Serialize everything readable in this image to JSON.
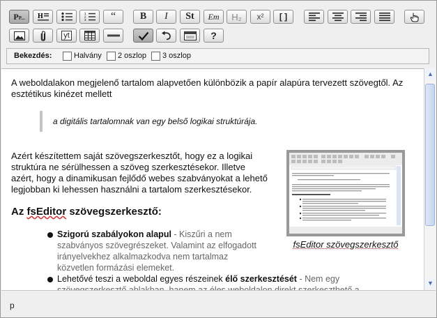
{
  "toolbar": {
    "row1": [
      {
        "name": "paragraph-style-button",
        "icon": "paragraph-style-icon",
        "text": "P..."
      },
      {
        "name": "heading-button",
        "icon": "heading-icon"
      },
      {
        "name": "bulleted-list-button",
        "icon": "bulleted-list-icon"
      },
      {
        "name": "numbered-list-button",
        "icon": "numbered-list-icon"
      },
      {
        "name": "quote-button",
        "icon": "quote-icon",
        "text": "“"
      },
      {
        "name": "bold-button",
        "icon": "bold-icon",
        "text": "B"
      },
      {
        "name": "italic-button",
        "icon": "italic-icon",
        "text": "I"
      },
      {
        "name": "strong-button",
        "icon": "strong-icon",
        "text": "St"
      },
      {
        "name": "emphasis-button",
        "icon": "emphasis-icon",
        "text": "Em"
      },
      {
        "name": "subscript-button",
        "icon": "subscript-icon",
        "text": "H₂"
      },
      {
        "name": "superscript-button",
        "icon": "superscript-icon",
        "text": "x²"
      },
      {
        "name": "code-button",
        "icon": "brackets-icon",
        "text": "[ ]"
      },
      {
        "name": "align-left-button",
        "icon": "align-left-icon"
      },
      {
        "name": "align-center-button",
        "icon": "align-center-icon"
      },
      {
        "name": "align-right-button",
        "icon": "align-right-icon"
      },
      {
        "name": "justify-button",
        "icon": "justify-icon"
      },
      {
        "name": "pointer-button",
        "icon": "hand-pointer-icon"
      }
    ],
    "row2": [
      {
        "name": "insert-image-button",
        "icon": "image-icon"
      },
      {
        "name": "attach-file-button",
        "icon": "paperclip-icon"
      },
      {
        "name": "youtube-button",
        "icon": "youtube-icon",
        "text": "yt"
      },
      {
        "name": "insert-table-button",
        "icon": "table-icon"
      },
      {
        "name": "horizontal-rule-button",
        "icon": "horizontal-rule-icon"
      },
      {
        "name": "validate-button",
        "icon": "checkmark-icon"
      },
      {
        "name": "undo-button",
        "icon": "undo-icon"
      },
      {
        "name": "source-button",
        "icon": "window-icon"
      },
      {
        "name": "help-button",
        "icon": "question-icon",
        "text": "?"
      }
    ]
  },
  "options": {
    "label": "Bekezdés:",
    "checkboxes": [
      {
        "label": "Halvány",
        "checked": false
      },
      {
        "label": "2 oszlop",
        "checked": false
      },
      {
        "label": "3 oszlop",
        "checked": false
      }
    ]
  },
  "content": {
    "intro": "A weboldalakon megjelenő tartalom alapvetően különbözik a papír alapúra tervezett szövegtől. Az esztétikus kinézet mellett",
    "quote": "a digitális tartalomnak van egy belső logikai struktúrája.",
    "para2": "Azért készítettem saját szövegszerkesztőt, hogy ez a logikai struktúra ne sérülhessen a szöveg szerkesztésekor. Illetve azért, hogy a dinamikusan fejlődő webes szabványokat a lehető legjobban ki lehessen használni a tartalom szerkesztésekor.",
    "heading_pre": "Az ",
    "heading_spell": "fsEditor",
    "heading_post": " szövegszerkesztő:",
    "image_caption": "fsEditor szövegszerkesztő",
    "bullets": [
      {
        "bold": "Szigorú szabályokon alapul",
        "rest": " - Kiszűri a nem szabványos szövegrészeket. Valamint az elfogadott irányelvekhez alkalmazkodva nem tartalmaz közvetlen formázási elemeket."
      },
      {
        "plain1": "Lehetővé teszi a weboldal egyes részeinek ",
        "bold": "élő szerkesztését",
        "rest": " - Nem egy szövegszerkesztő ablakban, hanem az éles weboldalon direkt szerkeszthető a"
      }
    ]
  },
  "status": {
    "path": "p"
  }
}
